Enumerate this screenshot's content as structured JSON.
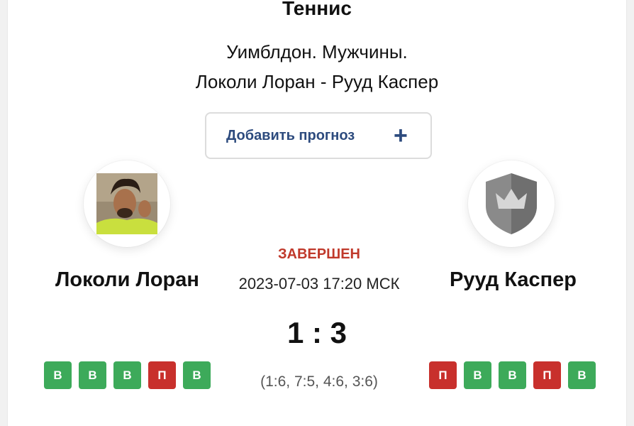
{
  "header": {
    "sport": "Теннис",
    "tournament": "Уимблдон. Мужчины.",
    "match": "Локоли Лоран - Рууд Каспер"
  },
  "forecast_button": {
    "label": "Добавить прогноз",
    "icon": "plus-icon"
  },
  "match": {
    "status": "ЗАВЕРШЕН",
    "datetime": "2023-07-03 17:20 МСК",
    "score": "1 : 3",
    "sets": "(1:6, 7:5, 4:6, 3:6)"
  },
  "home": {
    "name": "Локоли Лоран",
    "avatar": "player-photo",
    "form": [
      "В",
      "В",
      "В",
      "П",
      "В"
    ],
    "form_types": [
      "win",
      "win",
      "win",
      "loss",
      "win"
    ]
  },
  "away": {
    "name": "Рууд Каспер",
    "avatar": "shield-crown-icon",
    "form": [
      "П",
      "В",
      "В",
      "П",
      "В"
    ],
    "form_types": [
      "loss",
      "win",
      "win",
      "loss",
      "win"
    ]
  },
  "colors": {
    "win": "#3daa5a",
    "loss": "#c8302c",
    "status": "#c0392b",
    "accent": "#2d4b7e"
  }
}
